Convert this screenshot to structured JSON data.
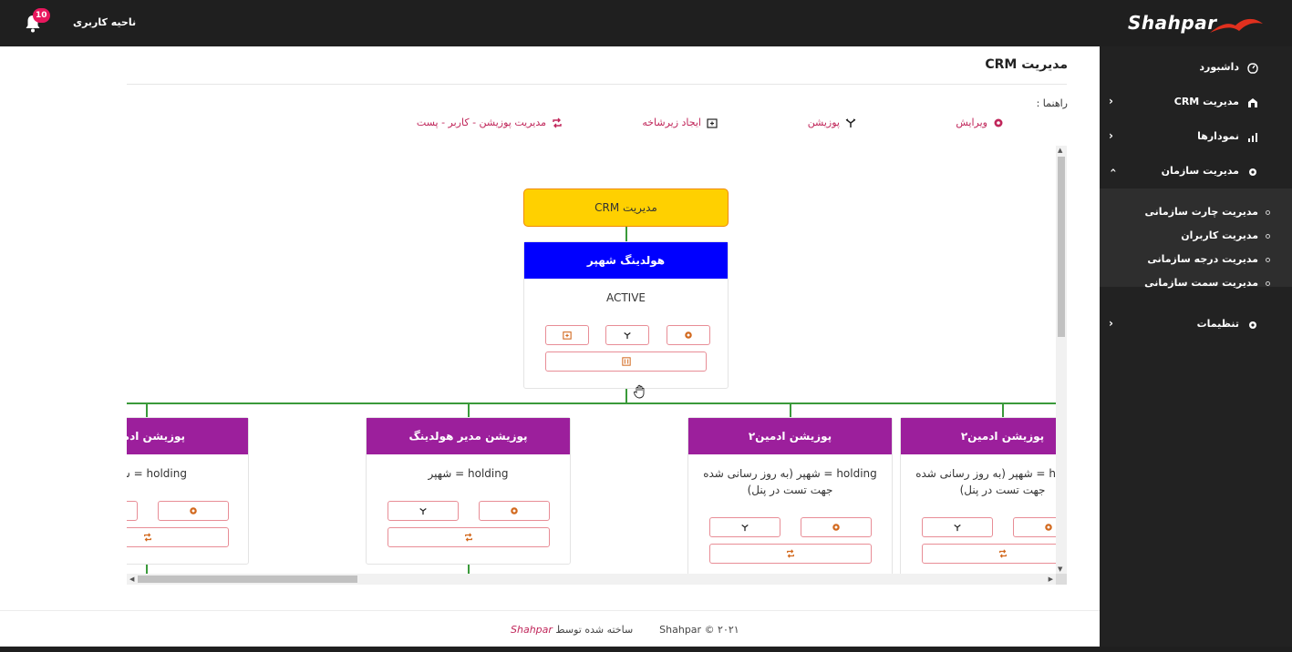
{
  "header": {
    "notification_count": "10",
    "user_area_label": "ناحیه کاربری",
    "logo_text": "Shahpar"
  },
  "sidebar": {
    "items": [
      {
        "label": "داشبورد",
        "icon": "dashboard-icon",
        "has_chevron": false
      },
      {
        "label": "مدیریت CRM",
        "icon": "crm-icon",
        "has_chevron": true
      },
      {
        "label": "نمودارها",
        "icon": "chart-icon",
        "has_chevron": true
      },
      {
        "label": "مدیریت سازمان",
        "icon": "gear-icon",
        "has_chevron": true,
        "expanded": true
      },
      {
        "label": "تنظیمات",
        "icon": "gear-icon",
        "has_chevron": true
      }
    ],
    "submenu": [
      {
        "label": "مدیریت چارت سازمانی"
      },
      {
        "label": "مدیریت کاربران"
      },
      {
        "label": "مدیریت درجه سازمانی"
      },
      {
        "label": "مدیریت سمت سازمانی"
      }
    ]
  },
  "main": {
    "title": "مدیریت CRM",
    "guide_label": "راهنما :",
    "legend": {
      "edit": "ویرایش",
      "position": "پوزیشن",
      "create_subbranch": "ایجاد زیرشاخه",
      "manage_position": "مدیریت پوزیشن - کاربر - پست"
    }
  },
  "chart": {
    "root": {
      "label": "مدیریت CRM"
    },
    "holding": {
      "title": "هولدینگ شهپر",
      "status": "ACTIVE"
    },
    "children": [
      {
        "title": "پوزیشن ادمین۲",
        "body": "holding = شهپر (به روز رسانی شده جهت تست در پنل)"
      },
      {
        "title": "پوزیشن ادمین۲",
        "body": "holding = شهپر (به روز رسانی شده جهت تست در پنل)"
      },
      {
        "title": "پوزیشن مدیر هولدینگ",
        "body": "holding = شهپر"
      },
      {
        "title": "پوزیشن ادمین",
        "body": "holding = شهپر"
      }
    ]
  },
  "footer": {
    "copyright": "Shahpar © ۲۰۲۱",
    "made_by": "ساخته شده توسط",
    "brand": "Shahpar"
  },
  "colors": {
    "topbar": "#1f1f1f",
    "sidebar": "#222222",
    "accent": "#c0265a",
    "root_node": "#ffd000",
    "holding_head": "#0000ff",
    "position_head": "#9c1f9c",
    "connector": "#3a9a3a"
  }
}
